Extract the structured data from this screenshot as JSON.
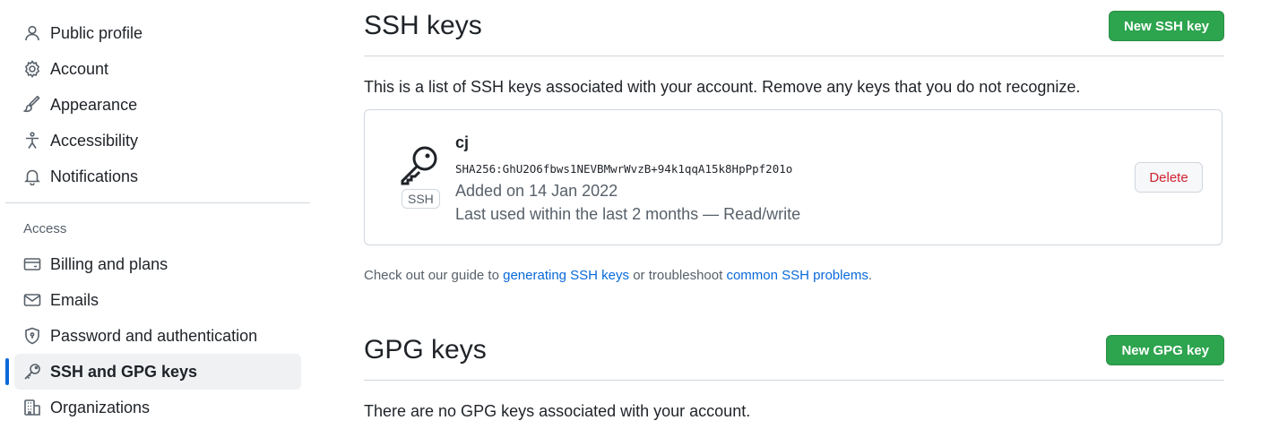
{
  "sidebar": {
    "items": [
      {
        "label": "Public profile",
        "icon": "person-icon"
      },
      {
        "label": "Account",
        "icon": "gear-icon"
      },
      {
        "label": "Appearance",
        "icon": "paintbrush-icon"
      },
      {
        "label": "Accessibility",
        "icon": "accessibility-icon"
      },
      {
        "label": "Notifications",
        "icon": "bell-icon"
      }
    ],
    "section_label": "Access",
    "access_items": [
      {
        "label": "Billing and plans",
        "icon": "credit-card-icon"
      },
      {
        "label": "Emails",
        "icon": "mail-icon"
      },
      {
        "label": "Password and authentication",
        "icon": "shield-lock-icon"
      },
      {
        "label": "SSH and GPG keys",
        "icon": "key-icon",
        "active": true
      },
      {
        "label": "Organizations",
        "icon": "organization-icon"
      }
    ]
  },
  "ssh": {
    "title": "SSH keys",
    "new_button": "New SSH key",
    "description": "This is a list of SSH keys associated with your account. Remove any keys that you do not recognize.",
    "key": {
      "name": "cj",
      "fingerprint": "SHA256:GhU2O6fbws1NEVBMwrWvzB+94k1qqA15k8HpPpf201o",
      "added": "Added on 14 Jan 2022",
      "last_used": "Last used within the last 2 months — Read/write",
      "badge": "SSH",
      "delete_label": "Delete"
    },
    "guide": {
      "prefix": "Check out our guide to ",
      "link1": "generating SSH keys",
      "middle": " or troubleshoot ",
      "link2": "common SSH problems",
      "suffix": "."
    }
  },
  "gpg": {
    "title": "GPG keys",
    "new_button": "New GPG key",
    "empty_text": "There are no GPG keys associated with your account."
  },
  "colors": {
    "primary_green": "#2da44e",
    "link_blue": "#0969da",
    "danger_red": "#cf222e",
    "active_indicator": "#0969da"
  }
}
